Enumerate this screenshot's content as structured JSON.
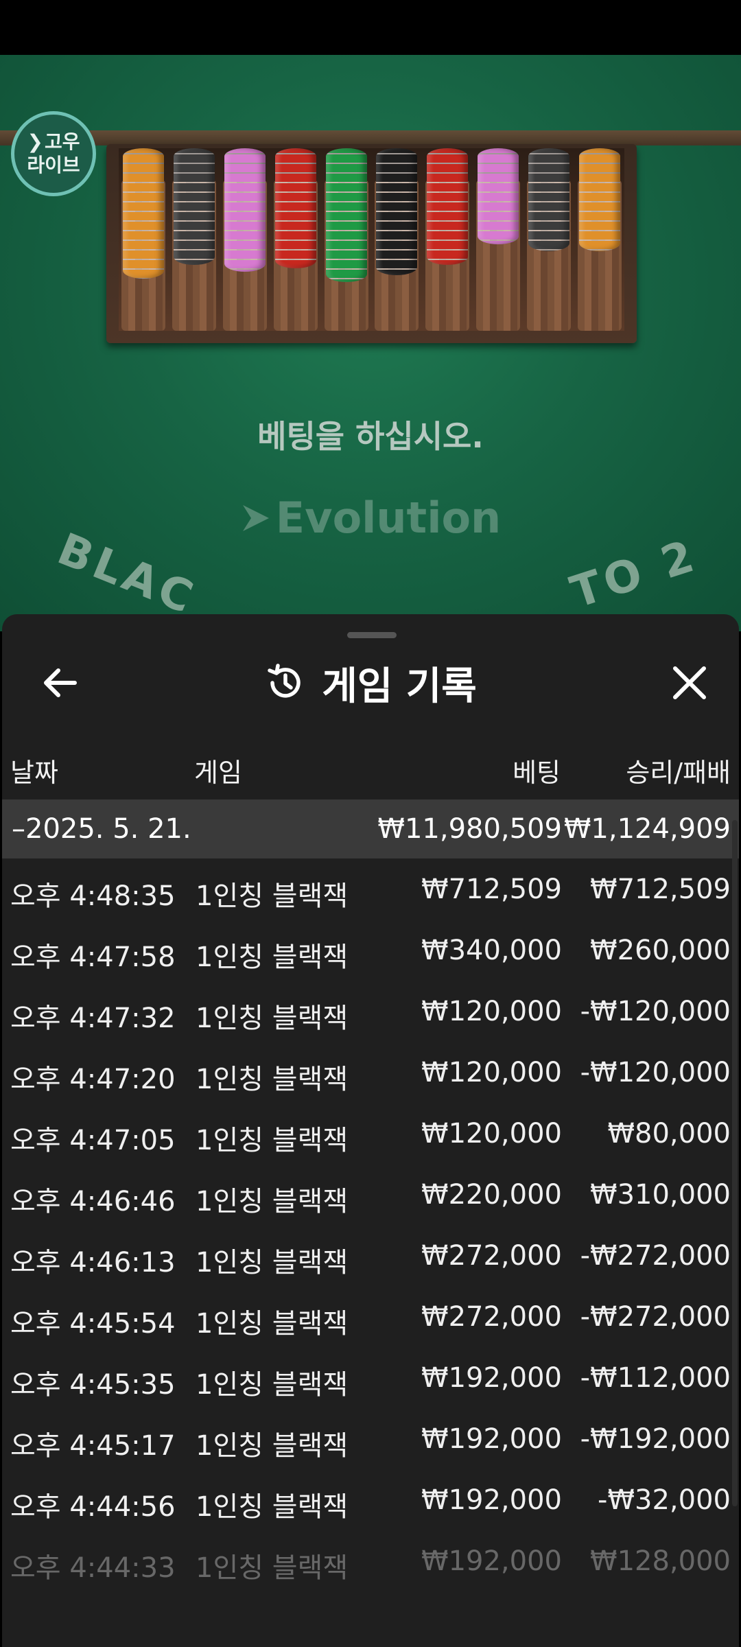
{
  "game_view": {
    "logo_line1": "고우",
    "logo_line2": "라이브",
    "prompt": "베팅을 하십시오.",
    "brand": "Evolution",
    "arc_left": "BLAC",
    "arc_right": "TO 2",
    "chip_colors": [
      "#e0902a",
      "#3c3c3c",
      "#d77ad0",
      "#c8281f",
      "#1f9a45",
      "#1e1e1e",
      "#c8281f",
      "#d77ad0",
      "#3c3c3c",
      "#e0902a"
    ]
  },
  "sheet": {
    "title": "게임 기록",
    "icons": {
      "back": "arrow-left-icon",
      "history": "history-icon",
      "close": "close-icon"
    },
    "columns": {
      "date": "날짜",
      "game": "게임",
      "bet": "베팅",
      "win": "승리/패배"
    },
    "date_group": {
      "date": "–2025. 5. 21.",
      "bet": "₩11,980,509",
      "win": "₩1,124,909"
    },
    "rows": [
      {
        "time": "오후 4:48:35",
        "game": "1인칭 블랙잭",
        "bet": "₩712,509",
        "win": "₩712,509"
      },
      {
        "time": "오후 4:47:58",
        "game": "1인칭 블랙잭",
        "bet": "₩340,000",
        "win": "₩260,000"
      },
      {
        "time": "오후 4:47:32",
        "game": "1인칭 블랙잭",
        "bet": "₩120,000",
        "win": "-₩120,000"
      },
      {
        "time": "오후 4:47:20",
        "game": "1인칭 블랙잭",
        "bet": "₩120,000",
        "win": "-₩120,000"
      },
      {
        "time": "오후 4:47:05",
        "game": "1인칭 블랙잭",
        "bet": "₩120,000",
        "win": "₩80,000"
      },
      {
        "time": "오후 4:46:46",
        "game": "1인칭 블랙잭",
        "bet": "₩220,000",
        "win": "₩310,000"
      },
      {
        "time": "오후 4:46:13",
        "game": "1인칭 블랙잭",
        "bet": "₩272,000",
        "win": "-₩272,000"
      },
      {
        "time": "오후 4:45:54",
        "game": "1인칭 블랙잭",
        "bet": "₩272,000",
        "win": "-₩272,000"
      },
      {
        "time": "오후 4:45:35",
        "game": "1인칭 블랙잭",
        "bet": "₩192,000",
        "win": "-₩112,000"
      },
      {
        "time": "오후 4:45:17",
        "game": "1인칭 블랙잭",
        "bet": "₩192,000",
        "win": "-₩192,000"
      },
      {
        "time": "오후 4:44:56",
        "game": "1인칭 블랙잭",
        "bet": "₩192,000",
        "win": "-₩32,000"
      },
      {
        "time": "오후 4:44:33",
        "game": "1인칭 블랙잭",
        "bet": "₩192,000",
        "win": "₩128,000"
      }
    ]
  }
}
